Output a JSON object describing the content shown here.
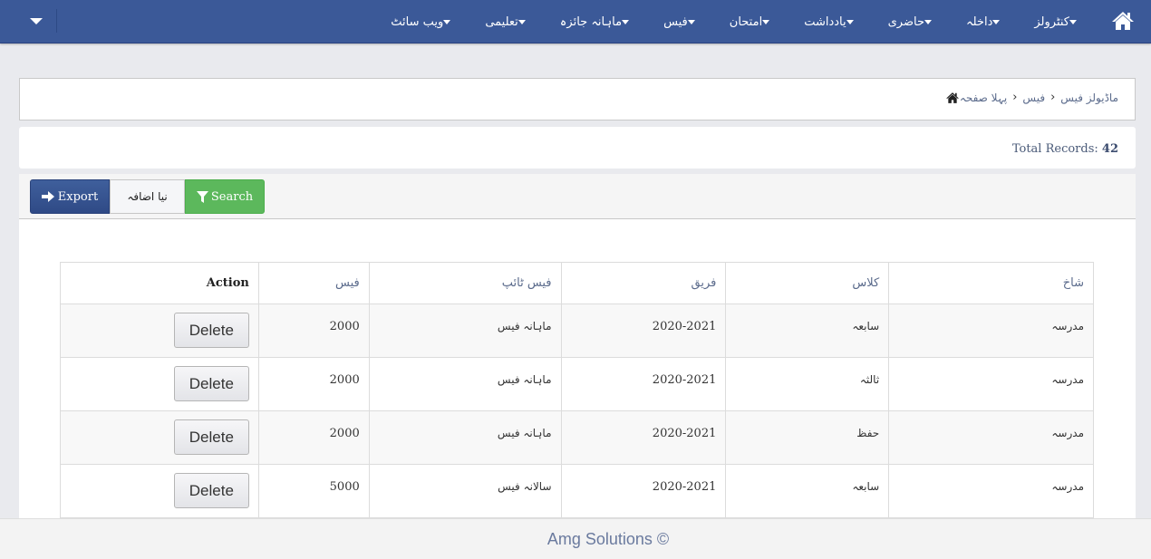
{
  "navbar": {
    "toggle_icon": "caret-down-icon",
    "home_icon": "home-icon",
    "menu": [
      {
        "label": "کنٹرولز"
      },
      {
        "label": "داخلہ"
      },
      {
        "label": "حاضری"
      },
      {
        "label": "یادداشت"
      },
      {
        "label": "امتحان"
      },
      {
        "label": "فیس"
      },
      {
        "label": "ماہانہ جائزہ"
      },
      {
        "label": "تعلیمی"
      },
      {
        "label": "ویب سائٹ"
      }
    ]
  },
  "breadcrumb": {
    "home_icon": "home-icon",
    "items": [
      "پہلا صفحہ",
      "فیس",
      "ماڈیولز فیس"
    ]
  },
  "records": {
    "label": "Total Records:",
    "count": "42"
  },
  "toolbar": {
    "export_label": "Export",
    "new_label": "نیا اضافہ",
    "search_label": "Search"
  },
  "table": {
    "headers": {
      "branch": "شاخ",
      "class": "کلاس",
      "session": "فریق",
      "fee_type": "فیس ٹائپ",
      "fee": "فیس",
      "action": "Action"
    },
    "rows": [
      {
        "branch": "مدرسہ",
        "class": "سابعہ",
        "session": "2020-2021",
        "fee_type": "ماہانہ فیس",
        "fee": "2000",
        "action": "Delete"
      },
      {
        "branch": "مدرسہ",
        "class": "ثالثہ",
        "session": "2020-2021",
        "fee_type": "ماہانہ فیس",
        "fee": "2000",
        "action": "Delete"
      },
      {
        "branch": "مدرسہ",
        "class": "حفظ",
        "session": "2020-2021",
        "fee_type": "ماہانہ فیس",
        "fee": "2000",
        "action": "Delete"
      },
      {
        "branch": "مدرسہ",
        "class": "سابعہ",
        "session": "2020-2021",
        "fee_type": "سالانہ فیس",
        "fee": "5000",
        "action": "Delete"
      }
    ]
  },
  "footer": {
    "text": "Amg Solutions ©"
  },
  "colors": {
    "navbar": "#3b5998",
    "export_button": "#2f4a86",
    "search_button": "#5cb85c",
    "background": "#e9eaee"
  }
}
